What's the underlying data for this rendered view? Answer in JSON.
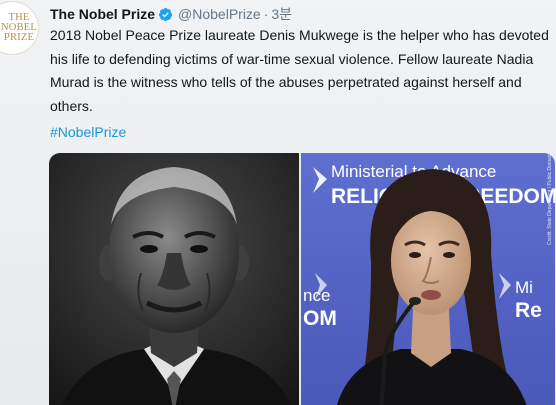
{
  "tweet": {
    "avatar_logo_lines": [
      "THE",
      "NOBEL",
      "PRIZE"
    ],
    "display_name": "The Nobel Prize",
    "handle": "@NobelPrize",
    "separator": "·",
    "timestamp": "3분",
    "text": "2018 Nobel Peace Prize laureate Denis Mukwege is the helper who has devoted his life to defending victims of war-time sexual violence. Fellow laureate Nadia Murad is the witness who tells of the abuses perpetrated against herself and others.",
    "hashtag": "#NobelPrize",
    "images": {
      "left": "Denis Mukwege portrait",
      "right": "Nadia Murad at podium"
    },
    "backdrop_sign_lines": [
      "Ministerial to Advance",
      "RELIGIOUS FREEDOM",
      "nce",
      "OM",
      "Mi",
      "Re"
    ],
    "photo_credit": "Credit: State Department / Public Domain"
  },
  "colors": {
    "text": "#14171a",
    "muted": "#657786",
    "link": "#1b95e0",
    "verified": "#1da1f2",
    "logo_gold": "#b6914b",
    "backdrop_blue": "#5a67c8"
  },
  "icons": {
    "verified": "verified-badge-icon"
  }
}
